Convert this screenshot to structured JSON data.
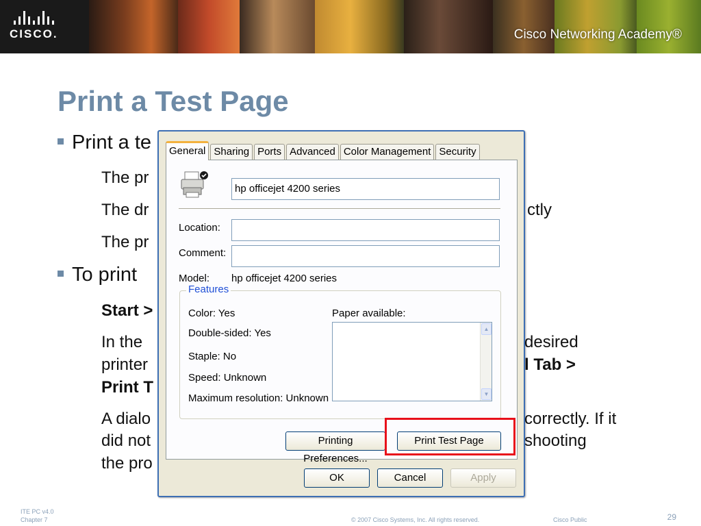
{
  "banner": {
    "academy": "Cisco Networking Academy®",
    "logo_text": "CISCO."
  },
  "slide": {
    "title": "Print a Test Page",
    "bullet1": "Print a te",
    "sub1": "The pr",
    "sub2a": "The dr",
    "sub2b": "ctly",
    "sub3": "The pr",
    "bullet2": "To print",
    "sub4_bold": "Start >",
    "sub5_line1a": "In the",
    "sub5_line1b": "desired",
    "sub5_line2a": "printer",
    "sub5_line2b": "l Tab >",
    "sub5_line3": "Print T",
    "sub6_line1a": "A dialo",
    "sub6_line1b": "correctly. If it",
    "sub6_line2a": "did not",
    "sub6_line2b": "shooting",
    "sub6_line3": "the pro"
  },
  "footer": {
    "course": "ITE PC v4.0",
    "chapter": "Chapter 7",
    "copyright": "© 2007 Cisco Systems, Inc. All rights reserved.",
    "classification": "Cisco Public",
    "page": "29"
  },
  "dialog": {
    "tabs": [
      "General",
      "Sharing",
      "Ports",
      "Advanced",
      "Color Management",
      "Security"
    ],
    "active_tab": "General",
    "printer_name": "hp officejet 4200 series",
    "location_label": "Location:",
    "location_value": "",
    "comment_label": "Comment:",
    "comment_value": "",
    "model_label": "Model:",
    "model_value": "hp officejet 4200 series",
    "features_title": "Features",
    "features": {
      "color": "Color: Yes",
      "double_sided": "Double-sided: Yes",
      "staple": "Staple: No",
      "speed": "Speed: Unknown",
      "max_resolution": "Maximum resolution: Unknown"
    },
    "paper_label": "Paper available:",
    "paper_options": [],
    "buttons": {
      "preferences": "Printing Preferences...",
      "test_page": "Print Test Page",
      "ok": "OK",
      "cancel": "Cancel",
      "apply": "Apply"
    }
  },
  "colors": {
    "title": "#6d8aa6",
    "highlight": "#e8101a",
    "dialog_border": "#3d6fb4",
    "tab_accent": "#f3b13e"
  }
}
